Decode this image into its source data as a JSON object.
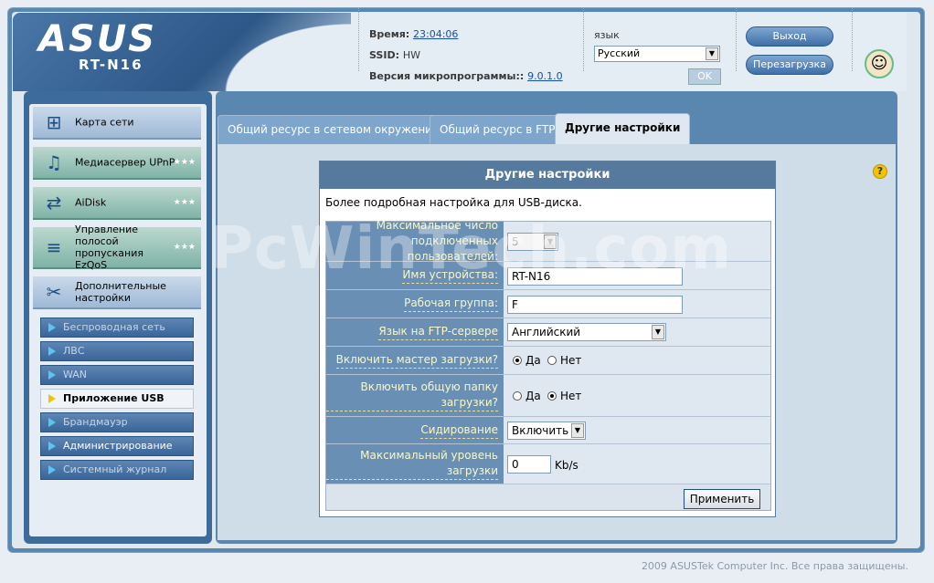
{
  "header": {
    "logo": "ASUS",
    "model": "RT-N16",
    "time_label": "Время:",
    "time_value": "23:04:06",
    "ssid_label": "SSID:",
    "ssid_value": "HW",
    "firmware_label": "Версия микропрограммы::",
    "firmware_value": "9.0.1.0",
    "lang_label": "язык",
    "lang_value": "Русский",
    "ok_label": "OK",
    "logout_label": "Выход",
    "reboot_label": "Перезагрузка"
  },
  "sidebar": {
    "items": [
      {
        "label": "Карта сети",
        "icon": "network-map-icon"
      },
      {
        "label": "Медиасервер UPnP",
        "icon": "media-server-icon"
      },
      {
        "label": "AiDisk",
        "icon": "aidisk-icon"
      },
      {
        "label": "Управление полосой пропускания EzQoS",
        "icon": "bandwidth-icon"
      },
      {
        "label": "Дополнительные настройки",
        "icon": "advanced-settings-icon"
      }
    ],
    "sub_items": [
      {
        "label": "Беспроводная сеть"
      },
      {
        "label": "ЛВС"
      },
      {
        "label": "WAN"
      },
      {
        "label": "Приложение USB"
      },
      {
        "label": "Брандмауэр"
      },
      {
        "label": "Администрирование"
      },
      {
        "label": "Системный журнал"
      }
    ]
  },
  "tabs": [
    {
      "label": "Общий ресурс в сетевом окружении"
    },
    {
      "label": "Общий ресурс в FTP"
    },
    {
      "label": "Другие настройки"
    }
  ],
  "panel": {
    "title": "Другие настройки",
    "description": "Более подробная настройка для USB-диска.",
    "max_users_label": "Максимальное число подключенных пользователей:",
    "max_users_value": "5",
    "device_name_label": "Имя устройства:",
    "device_name_value": "RT-N16",
    "workgroup_label": "Рабочая группа:",
    "workgroup_value": "F",
    "ftp_lang_label": "Язык на FTP-сервере",
    "ftp_lang_value": "Английский",
    "download_master_label": "Включить мастер загрузки?",
    "shared_folder_label": "Включить общую папку загрузки?",
    "yes_label": "Да",
    "no_label": "Нет",
    "seeding_label": "Сидирование",
    "seeding_value": "Включить",
    "max_dl_label": "Максимальный уровень загрузки",
    "max_dl_value": "0",
    "max_dl_unit": "Kb/s",
    "apply_label": "Применить"
  },
  "footer": "2009 ASUSTek Computer Inc. Все права защищены.",
  "watermark": "PcWinTech.com"
}
